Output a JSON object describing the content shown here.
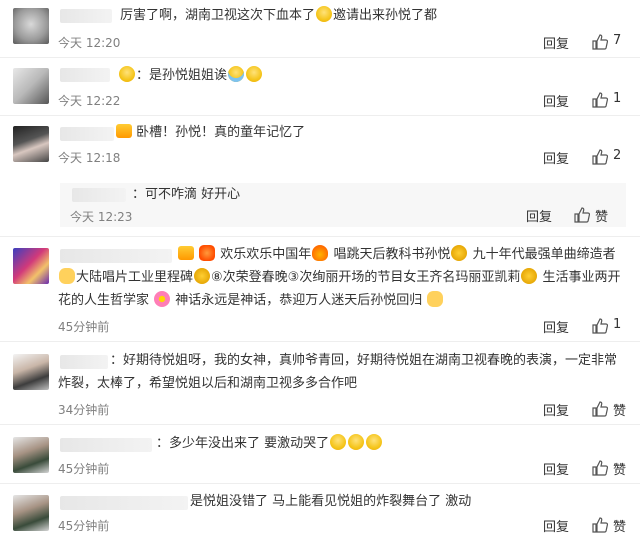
{
  "reply_label": "回复",
  "like_word": "赞",
  "comments": [
    {
      "text": "厉害了啊，湖南卫视这次下血本了",
      "text2": "邀请出来孙悦了都",
      "time": "今天 12:20",
      "likes": "7"
    },
    {
      "text": "：是孙悦姐姐诶",
      "time": "今天 12:22",
      "likes": "1"
    },
    {
      "text": "卧槽！孙悦！真的童年记忆了",
      "time": "今天 12:18",
      "likes": "2"
    },
    {
      "text": "：可不咋滴 好开心",
      "time": "今天 12:23",
      "likes": ""
    },
    {
      "line1a": "欢乐欢乐中国年",
      "line1b": "唱跳天后教科书孙悦",
      "line1c": "九十年代最强单曲缔造者",
      "line2a": "大陆唱片工业里程碑",
      "line2b": "⑧次荣登春晚③次绚丽开场的节目女王齐名玛丽亚凯莉",
      "line2c": "生活事业两开",
      "line3a": "花的人生哲学家",
      "line3b": "神话永远是神话，恭迎万人迷天后孙悦回归",
      "time": "45分钟前",
      "likes": "1"
    },
    {
      "line1": "：好期待悦姐呀，我的女神，真帅爷青回，好期待悦姐在湖南卫视春晚的表演，一定非常",
      "line2": "炸裂，太棒了，希望悦姐以后和湖南卫视多多合作吧",
      "time": "34分钟前",
      "likes": ""
    },
    {
      "text": "：多少年没出来了 要激动哭了",
      "time": "45分钟前",
      "likes": ""
    },
    {
      "text": "是悦姐没错了 马上能看见悦姐的炸裂舞台了 激动",
      "time": "45分钟前",
      "likes": ""
    }
  ]
}
